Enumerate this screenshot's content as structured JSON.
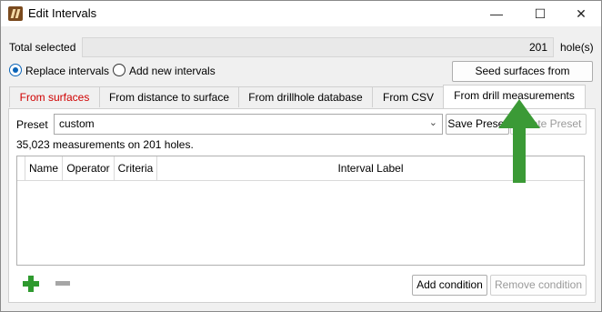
{
  "window": {
    "title": "Edit Intervals",
    "controls": {
      "minimize": "—",
      "maximize": "☐",
      "close": "✕"
    }
  },
  "selection": {
    "total_label": "Total selected",
    "total_value": "201",
    "unit_label": "hole(s)"
  },
  "mode": {
    "replace_label": "Replace intervals",
    "replace_checked": true,
    "add_label": "Add new intervals",
    "add_checked": false
  },
  "seed_button_label": "Seed surfaces from selection",
  "tabs": [
    {
      "label": "From surfaces",
      "color": "#d00000",
      "active": false
    },
    {
      "label": "From distance to surface",
      "active": false
    },
    {
      "label": "From drillhole database",
      "active": false
    },
    {
      "label": "From CSV",
      "active": false
    },
    {
      "label": "From drill measurements",
      "active": true
    }
  ],
  "preset": {
    "label": "Preset",
    "value": "custom",
    "save_label": "Save Preset",
    "delete_label": "Delete Preset"
  },
  "measurements_text": "35,023 measurements on 201 holes.",
  "table": {
    "columns": [
      "Name",
      "Operator",
      "Criteria",
      "Interval Label"
    ],
    "rows": []
  },
  "footer": {
    "add_icon": "plus-icon",
    "remove_icon": "minus-icon",
    "add_condition_label": "Add condition",
    "remove_condition_label": "Remove condition"
  },
  "annotation": {
    "arrow_color": "#3b9a36",
    "arrow_direction": "up"
  }
}
